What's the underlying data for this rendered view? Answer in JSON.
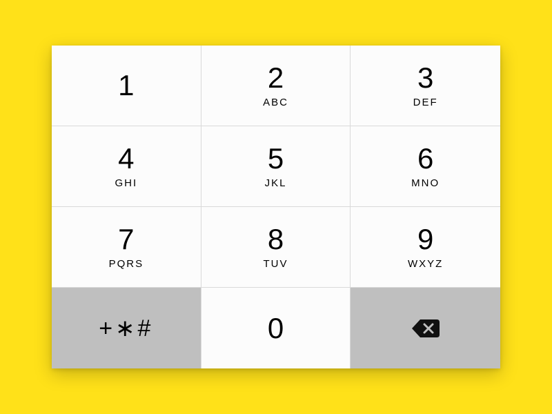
{
  "keys": {
    "k1": {
      "digit": "1",
      "letters": ""
    },
    "k2": {
      "digit": "2",
      "letters": "ABC"
    },
    "k3": {
      "digit": "3",
      "letters": "DEF"
    },
    "k4": {
      "digit": "4",
      "letters": "GHI"
    },
    "k5": {
      "digit": "5",
      "letters": "JKL"
    },
    "k6": {
      "digit": "6",
      "letters": "MNO"
    },
    "k7": {
      "digit": "7",
      "letters": "PQRS"
    },
    "k8": {
      "digit": "8",
      "letters": "TUV"
    },
    "k9": {
      "digit": "9",
      "letters": "WXYZ"
    },
    "ksym": {
      "glyphs": "+∗#"
    },
    "k0": {
      "digit": "0"
    },
    "kback": {
      "icon": "backspace-icon"
    }
  }
}
